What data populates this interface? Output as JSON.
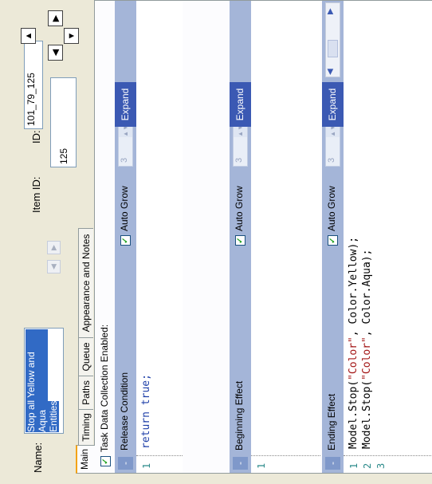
{
  "header": {
    "name_label": "Name:",
    "name_lines": [
      "Stop all Yellow and Aqua",
      "Entities"
    ],
    "id_label": "ID:",
    "id_value": "101_79_125",
    "item_id_label": "Item ID:",
    "item_id_value": "125"
  },
  "tabs": [
    "Main",
    "Timing",
    "Paths",
    "Queue",
    "Appearance and Notes"
  ],
  "main": {
    "task_data_label": "Task Data Collection Enabled:",
    "sections": [
      {
        "title": "Release Condition",
        "auto_grow_label": "Auto Grow",
        "spin_value": "3",
        "expand_label": "Expand",
        "lines": [
          {
            "num": "1",
            "code": "return true;"
          }
        ]
      },
      {
        "title": "Beginning Effect",
        "auto_grow_label": "Auto Grow",
        "spin_value": "3",
        "expand_label": "Expand",
        "lines": [
          {
            "num": "1",
            "code": ""
          }
        ]
      },
      {
        "title": "Ending Effect",
        "auto_grow_label": "Auto Grow",
        "spin_value": "3",
        "expand_label": "Expand",
        "lines": [
          {
            "num": "1",
            "code": "Model.Stop(\"Color\", Color.Yellow);"
          },
          {
            "num": "2",
            "code": "Model.Stop(\"Color\", Color.Aqua);"
          },
          {
            "num": "3",
            "code": ""
          }
        ]
      }
    ]
  },
  "colors": {
    "section_bar": "#a4b5d8",
    "expand_button": "#3b59b3",
    "active_tab_accent": "#f3a317",
    "selection": "#316ac5"
  },
  "icons": {
    "nav": [
      "arrow-up-icon",
      "arrow-left-icon",
      "arrow-right-icon",
      "arrow-down-icon"
    ],
    "check": "checkmark-icon"
  }
}
